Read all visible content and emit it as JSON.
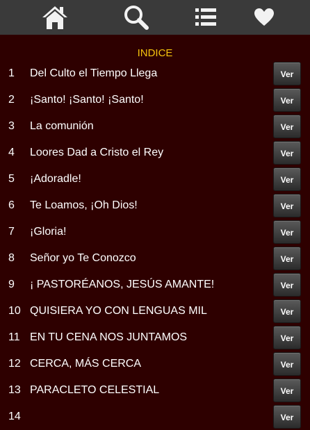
{
  "toolbar": {
    "items": [
      {
        "icon": "home-icon"
      },
      {
        "icon": "search-icon"
      },
      {
        "icon": "list-icon"
      },
      {
        "icon": "heart-icon"
      }
    ]
  },
  "index_title": "INDICE",
  "button_label": "Ver",
  "songs": [
    {
      "number": "1",
      "title": "Del Culto el Tiempo Llega"
    },
    {
      "number": "2",
      "title": "¡Santo! ¡Santo! ¡Santo!"
    },
    {
      "number": "3",
      "title": "La comunión"
    },
    {
      "number": "4",
      "title": "Loores Dad a Cristo el Rey"
    },
    {
      "number": "5",
      "title": "¡Adoradle!"
    },
    {
      "number": "6",
      "title": "Te Loamos, ¡Oh Dios!"
    },
    {
      "number": "7",
      "title": "¡Gloria!"
    },
    {
      "number": "8",
      "title": "Señor yo Te Conozco"
    },
    {
      "number": "9",
      "title": "¡ PASTORÉANOS, JESÚS AMANTE!"
    },
    {
      "number": "10",
      "title": "QUISIERA YO CON LENGUAS MIL"
    },
    {
      "number": "11",
      "title": "EN TU CENA NOS JUNTAMOS"
    },
    {
      "number": "12",
      "title": "CERCA, MÁS CERCA"
    },
    {
      "number": "13",
      "title": "PARACLETO CELESTIAL"
    },
    {
      "number": "14",
      "title": ""
    }
  ],
  "colors": {
    "background": "#2e0000",
    "toolbar": "#3a3a3a",
    "title": "#f4c20d",
    "text": "#ffffff"
  }
}
